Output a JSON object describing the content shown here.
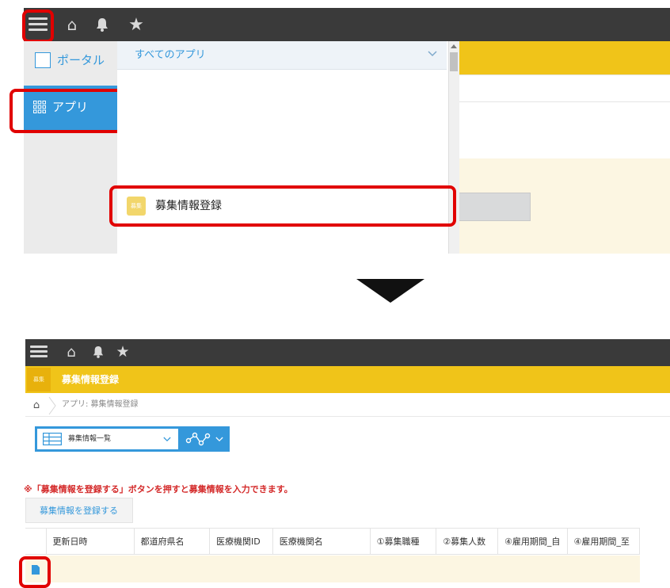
{
  "top_panel": {
    "sidebar": {
      "portal_label": "ポータル",
      "app_label": "アプリ"
    },
    "dropdown": {
      "header_label": "すべてのアプリ",
      "app_item_icon_text": "募集",
      "app_item_label": "募集情報登録"
    }
  },
  "bottom_panel": {
    "app_header": {
      "icon_text": "募集",
      "title": "募集情報登録"
    },
    "breadcrumb": {
      "path": "アプリ: 募集情報登録"
    },
    "view_select": {
      "label": "募集情報一覧"
    },
    "notice": "※「募集情報を登録する」ボタンを押すと募集情報を入力できます。",
    "register_button": "募集情報を登録する",
    "table": {
      "columns": [
        "更新日時",
        "都道府県名",
        "医療機関ID",
        "医療機関名",
        "①募集職種",
        "②募集人数",
        "④雇用期間_自",
        "④雇用期間_至"
      ]
    }
  },
  "colors": {
    "topbar": "#3a3a3a",
    "accent_yellow": "#f0c419",
    "sidebar_blue": "#3498db",
    "highlight_red": "#e10000",
    "row_cream": "#fcf6e2"
  }
}
